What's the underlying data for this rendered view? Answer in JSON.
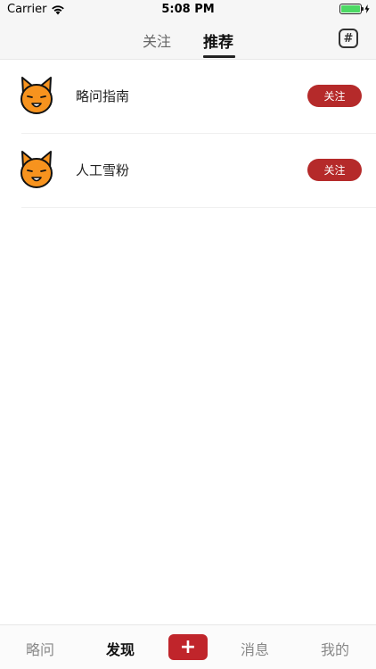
{
  "status_bar": {
    "carrier": "Carrier",
    "time": "5:08 PM",
    "battery_level": 1.0,
    "battery_color": "#4cd964"
  },
  "top_nav": {
    "tabs": [
      "关注",
      "推荐"
    ],
    "active_tab": "推荐",
    "topic_icon_glyph": "#"
  },
  "list": [
    {
      "name": "略问指南",
      "follow_label": "关注",
      "avatar_icon": "fox-avatar-icon"
    },
    {
      "name": "人工雪粉",
      "follow_label": "关注",
      "avatar_icon": "fox-avatar-icon"
    }
  ],
  "bottom_bar": {
    "tabs": [
      "略问",
      "发现",
      "消息",
      "我的"
    ],
    "active_tab": "发现",
    "add_glyph": "+",
    "accent": "#c0252b"
  }
}
